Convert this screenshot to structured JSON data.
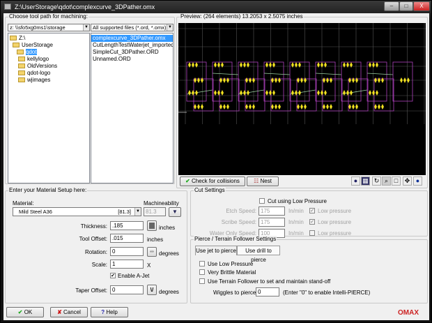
{
  "window": {
    "title": "Z:\\UserStorage\\qdot\\complexcurve_3DPather.omx",
    "minimize": "–",
    "maximize": "□",
    "close": "X"
  },
  "toolpath": {
    "group_label": "Choose tool path for machining:",
    "drive": "z: \\\\sfo5xg0ms1\\storage",
    "filter": "All supported files (*.ord, *.omx)",
    "folders": [
      {
        "label": "Z:\\",
        "open": true
      },
      {
        "label": "UserStorage",
        "open": true
      },
      {
        "label": "qdot",
        "open": true,
        "selected": true
      },
      {
        "label": "kellylogo"
      },
      {
        "label": "OldVersions"
      },
      {
        "label": "qdot-logo"
      },
      {
        "label": "wjimages"
      }
    ],
    "files": [
      {
        "label": "complexcurve_3DPather.omx",
        "selected": true
      },
      {
        "label": "CutLengthTestWaterjet_imported_ai"
      },
      {
        "label": "SimpleCut_3DPather.ORD"
      },
      {
        "label": "Unnamed.ORD"
      }
    ]
  },
  "preview": {
    "label": "Preview: (264 elements) 13.2053 x 2.5075 inches",
    "check_collisions": "Check for collisions",
    "nest": "Nest",
    "tools": [
      "color-icon",
      "layers-icon",
      "rotate-icon",
      "zoom-icon",
      "zoom-box-icon",
      "pan-icon",
      "info-icon"
    ],
    "colors": {
      "background": "#000000",
      "grid": "#555555",
      "path": "#b040c0",
      "traverse": "#9ad0a0",
      "marker": "#f0e020"
    }
  },
  "material": {
    "group_label": "Enter your Material Setup here:",
    "material_label": "Material:",
    "material_value": "Mild Steel A36",
    "material_index": "[81.3]",
    "machineability_label": "Machineability",
    "machineability_value": "81.3",
    "thickness_label": "Thickness:",
    "thickness_value": ".185",
    "thickness_unit": "inches",
    "tool_offset_label": "Tool Offset:",
    "tool_offset_value": ".015",
    "tool_offset_unit": "inches",
    "rotation_label": "Rotation:",
    "rotation_value": "0",
    "rotation_unit": "degrees",
    "scale_label": "Scale:",
    "scale_value": "1",
    "scale_unit": "X",
    "enable_ajet_label": "Enable A-Jet",
    "enable_ajet_checked": true,
    "taper_label": "Taper Offset:",
    "taper_value": "0",
    "taper_unit": "degrees"
  },
  "cut": {
    "group_label": "Cut Settings",
    "low_pressure_label": "Cut using Low Pressure",
    "rows": [
      {
        "label": "Etch Speed:",
        "value": "175",
        "unit": "In/min",
        "lp": "Low pressure",
        "checked": true
      },
      {
        "label": "Scribe Speed:",
        "value": "175",
        "unit": "In/min",
        "lp": "Low pressure",
        "checked": true
      },
      {
        "label": "Water Only Speed:",
        "value": "100",
        "unit": "In/min",
        "lp": "Low pressure",
        "checked": false
      }
    ]
  },
  "pierce": {
    "group_label": "Pierce / Terrain Follower Settings",
    "tab_jet": "Use jet to pierce",
    "tab_drill": "Use drill to pierce",
    "low_pressure": "Use Low Pressure",
    "brittle": "Very Brittle Material",
    "terrain": "Use Terrain Follower to set and maintain stand-off",
    "wiggles_label": "Wiggles to pierce:",
    "wiggles_value": "0",
    "wiggles_hint": "(Enter \"0\" to enable Intelli-PIERCE)"
  },
  "footer": {
    "ok": "OK",
    "cancel": "Cancel",
    "help": "Help",
    "logo": "OMAX"
  }
}
